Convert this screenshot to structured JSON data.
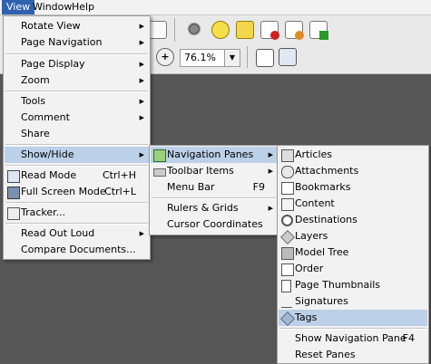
{
  "menubar": {
    "items": [
      "View",
      "Window",
      "Help"
    ]
  },
  "toolbar": {
    "zoom_value": "76.1%"
  },
  "view_menu": {
    "items": [
      {
        "label": "Rotate View",
        "arrow": "▶"
      },
      {
        "label": "Page Navigation",
        "arrow": "▶"
      },
      {
        "label": "Page Display",
        "arrow": "▶"
      },
      {
        "label": "Zoom",
        "arrow": "▶"
      },
      {
        "label": "Tools",
        "arrow": "▶"
      },
      {
        "label": "Comment",
        "arrow": "▶"
      },
      {
        "label": "Share"
      },
      {
        "label": "Show/Hide",
        "arrow": "▶"
      },
      {
        "label": "Read Mode",
        "shortcut": "Ctrl+H"
      },
      {
        "label": "Full Screen Mode",
        "shortcut": "Ctrl+L"
      },
      {
        "label": "Tracker..."
      },
      {
        "label": "Read Out Loud",
        "arrow": "▶"
      },
      {
        "label": "Compare Documents..."
      }
    ]
  },
  "showhide_menu": {
    "items": [
      {
        "label": "Navigation Panes",
        "arrow": "▶"
      },
      {
        "label": "Toolbar Items",
        "arrow": "▶"
      },
      {
        "label": "Menu Bar",
        "shortcut": "F9"
      },
      {
        "label": "Rulers & Grids",
        "arrow": "▶"
      },
      {
        "label": "Cursor Coordinates"
      }
    ]
  },
  "navpanes_menu": {
    "items": [
      {
        "label": "Articles"
      },
      {
        "label": "Attachments"
      },
      {
        "label": "Bookmarks"
      },
      {
        "label": "Content"
      },
      {
        "label": "Destinations"
      },
      {
        "label": "Layers"
      },
      {
        "label": "Model Tree"
      },
      {
        "label": "Order"
      },
      {
        "label": "Page Thumbnails"
      },
      {
        "label": "Signatures"
      },
      {
        "label": "Tags"
      },
      {
        "label": "Show Navigation Pane",
        "shortcut": "F4"
      },
      {
        "label": "Reset Panes"
      }
    ]
  }
}
